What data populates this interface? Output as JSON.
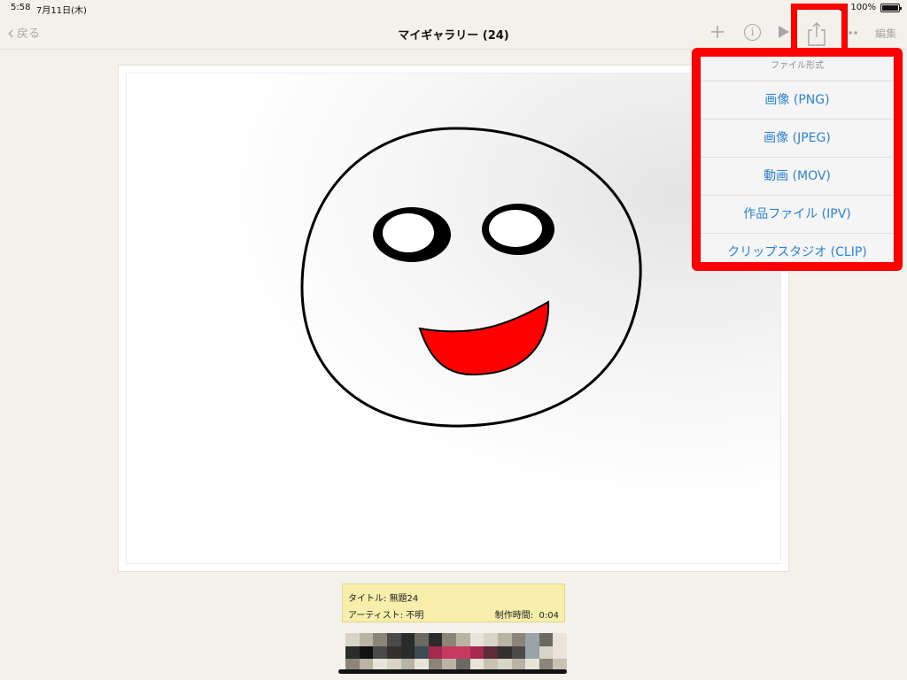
{
  "status_bar": {
    "time": "5:58",
    "date": "7月11日(木)",
    "battery_text": "100%"
  },
  "nav": {
    "back_label": "戻る",
    "title": "マイギャラリー (24)",
    "edit_label": "編集",
    "icons": [
      "plus-icon",
      "info-icon",
      "play-icon",
      "share-icon",
      "more-icon"
    ]
  },
  "export_menu": {
    "header": "ファイル形式",
    "items": [
      "画像 (PNG)",
      "画像 (JPEG)",
      "動画 (MOV)",
      "作品ファイル (IPV)",
      "クリップスタジオ (CLIP)"
    ],
    "highlight_color": "#ff0000"
  },
  "artwork_info": {
    "title_label": "タイトル:",
    "title_value": "無題24",
    "artist_label": "アーティスト:",
    "artist_value": "不明",
    "time_label": "制作時間:",
    "time_value": "0:04"
  },
  "colors": {
    "accent": "#2d82d8",
    "highlight": "#ff0000",
    "card": "#f6eeaa"
  }
}
